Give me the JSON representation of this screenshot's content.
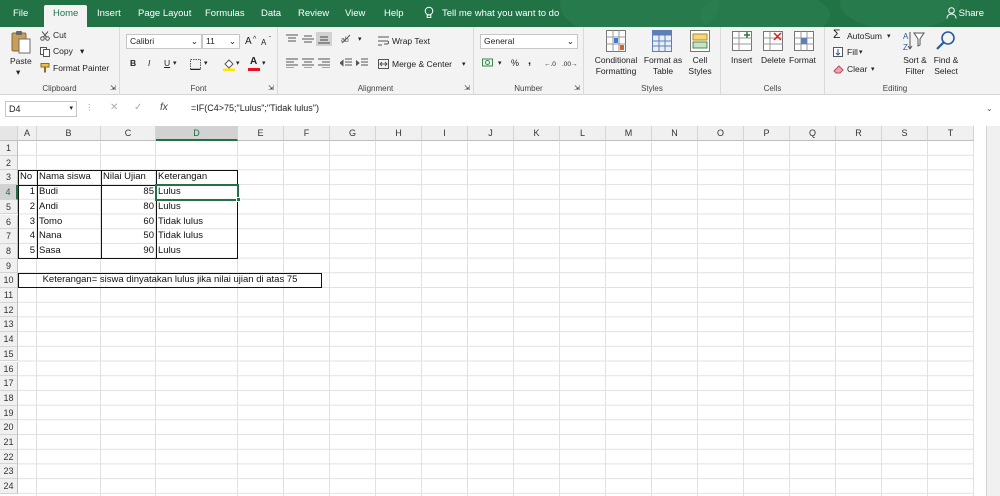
{
  "tabs": [
    {
      "label": "File"
    },
    {
      "label": "Home"
    },
    {
      "label": "Insert"
    },
    {
      "label": "Page Layout"
    },
    {
      "label": "Formulas"
    },
    {
      "label": "Data"
    },
    {
      "label": "Review"
    },
    {
      "label": "View"
    },
    {
      "label": "Help"
    }
  ],
  "tell_me": "Tell me what you want to do",
  "share": "Share",
  "ribbon": {
    "clipboard": {
      "paste": "Paste",
      "cut": "Cut",
      "copy": "Copy",
      "format_painter": "Format Painter",
      "label": "Clipboard"
    },
    "font": {
      "name": "Calibri",
      "size": "11",
      "bold": "B",
      "italic": "I",
      "underline": "U",
      "grow": "A",
      "shrink": "A",
      "font_color": "A",
      "label": "Font"
    },
    "alignment": {
      "wrap_text": "Wrap Text",
      "merge_center": "Merge & Center",
      "label": "Alignment"
    },
    "number": {
      "format": "General",
      "percent": "%",
      "comma": ",",
      "label": "Number"
    },
    "styles": {
      "conditional": "Conditional Formatting",
      "format_as_table": "Format as Table",
      "cell_styles": "Cell Styles",
      "label": "Styles"
    },
    "cells": {
      "insert": "Insert",
      "delete": "Delete",
      "format": "Format",
      "label": "Cells"
    },
    "editing": {
      "autosum": "AutoSum",
      "fill": "Fill",
      "clear": "Clear",
      "sort_filter": "Sort & Filter",
      "find_select": "Find & Select",
      "label": "Editing"
    }
  },
  "formula_bar": {
    "name_box": "D4",
    "formula": "=IF(C4>75;\"Lulus\";\"Tidak lulus\")"
  },
  "columns": [
    "A",
    "B",
    "C",
    "D",
    "E",
    "F",
    "G",
    "H",
    "I",
    "J",
    "K",
    "L",
    "M",
    "N",
    "O",
    "P",
    "Q",
    "R",
    "S",
    "T"
  ],
  "rows": [
    "1",
    "2",
    "3",
    "4",
    "5",
    "6",
    "7",
    "8",
    "9",
    "10",
    "11",
    "12",
    "13",
    "14",
    "15",
    "16",
    "17",
    "18",
    "19",
    "20",
    "21",
    "22",
    "23",
    "24"
  ],
  "table": {
    "headers": [
      "No",
      "Nama siswa",
      "Nilai Ujian",
      "Keterangan"
    ],
    "rows": [
      {
        "no": "1",
        "nama": "Budi",
        "nilai": "85",
        "ket": "Lulus"
      },
      {
        "no": "2",
        "nama": "Andi",
        "nilai": "80",
        "ket": "Lulus"
      },
      {
        "no": "3",
        "nama": "Tomo",
        "nilai": "60",
        "ket": "Tidak lulus"
      },
      {
        "no": "4",
        "nama": "Nana",
        "nilai": "50",
        "ket": "Tidak lulus"
      },
      {
        "no": "5",
        "nama": "Sasa",
        "nilai": "90",
        "ket": "Lulus"
      }
    ]
  },
  "note": "Keterangan= siswa dinyatakan lulus jika nilai ujian di atas 75",
  "colors": {
    "accent": "#217346",
    "font_color": "#e81123",
    "highlight": "#ffe600"
  }
}
